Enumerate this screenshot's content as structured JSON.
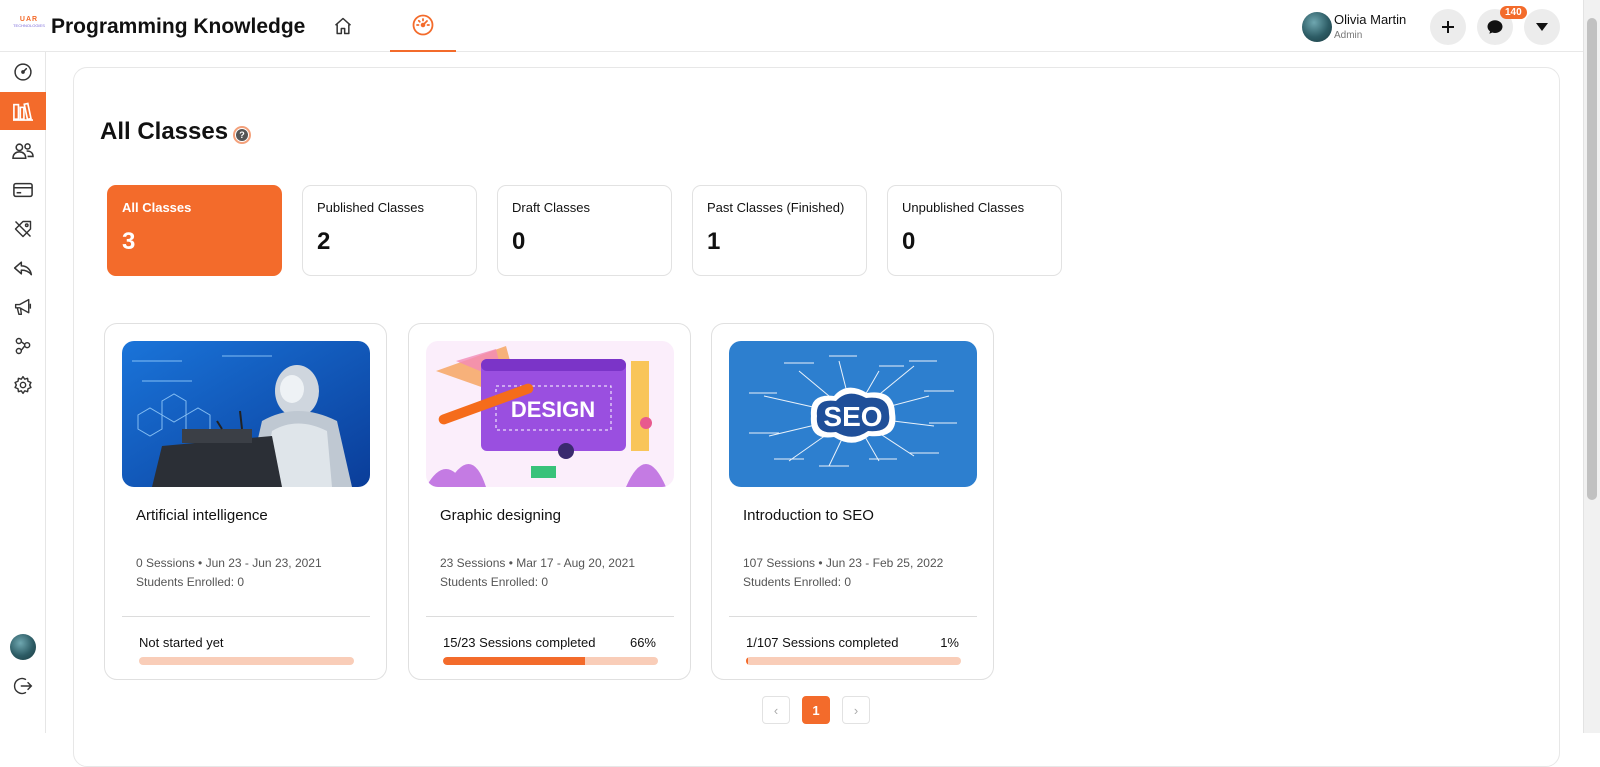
{
  "app": {
    "logo_top": "UAR",
    "logo_bottom": "TECHNOLOGIES",
    "title": "Programming Knowledge"
  },
  "user": {
    "name": "Olivia Martin",
    "role": "Admin",
    "notifications_count": "140"
  },
  "nav": {
    "tabs": [
      {
        "icon": "home-icon",
        "active": false
      },
      {
        "icon": "speedometer-icon",
        "active": true
      }
    ]
  },
  "sidebar": {
    "items": [
      {
        "icon": "speedometer-icon",
        "active": false
      },
      {
        "icon": "library-icon",
        "active": true
      },
      {
        "icon": "users-icon",
        "active": false
      },
      {
        "icon": "credit-card-icon",
        "active": false
      },
      {
        "icon": "tag-icon",
        "active": false
      },
      {
        "icon": "reply-icon",
        "active": false
      },
      {
        "icon": "megaphone-icon",
        "active": false
      },
      {
        "icon": "network-icon",
        "active": false
      },
      {
        "icon": "gear-icon",
        "active": false
      }
    ]
  },
  "page": {
    "title": "All Classes",
    "help_glyph": "?"
  },
  "stats": [
    {
      "label": "All Classes",
      "value": "3",
      "active": true
    },
    {
      "label": "Published Classes",
      "value": "2",
      "active": false
    },
    {
      "label": "Draft Classes",
      "value": "0",
      "active": false
    },
    {
      "label": "Past Classes (Finished)",
      "value": "1",
      "active": false
    },
    {
      "label": "Unpublished Classes",
      "value": "0",
      "active": false
    }
  ],
  "classes": [
    {
      "title": "Artificial intelligence",
      "meta": "0 Sessions • Jun 23 - Jun 23, 2021",
      "enrolled": "Students Enrolled: 0",
      "progress_label": "Not started yet",
      "progress_pct": "",
      "progress": 0
    },
    {
      "title": "Graphic designing",
      "meta": "23 Sessions • Mar 17 - Aug 20, 2021",
      "enrolled": "Students Enrolled: 0",
      "progress_label": "15/23 Sessions completed",
      "progress_pct": "66%",
      "progress": 0.66,
      "image_text": "DESIGN"
    },
    {
      "title": "Introduction to SEO",
      "meta": "107 Sessions • Jun 23 - Feb 25, 2022",
      "enrolled": "Students Enrolled: 0",
      "progress_label": "1/107 Sessions completed",
      "progress_pct": "1%",
      "progress": 0.01,
      "image_text": "SEO"
    }
  ],
  "pagination": {
    "prev": "‹",
    "current": "1",
    "next": "›"
  },
  "colors": {
    "accent": "#f36b2b",
    "accent_light": "#f9cdb8"
  }
}
